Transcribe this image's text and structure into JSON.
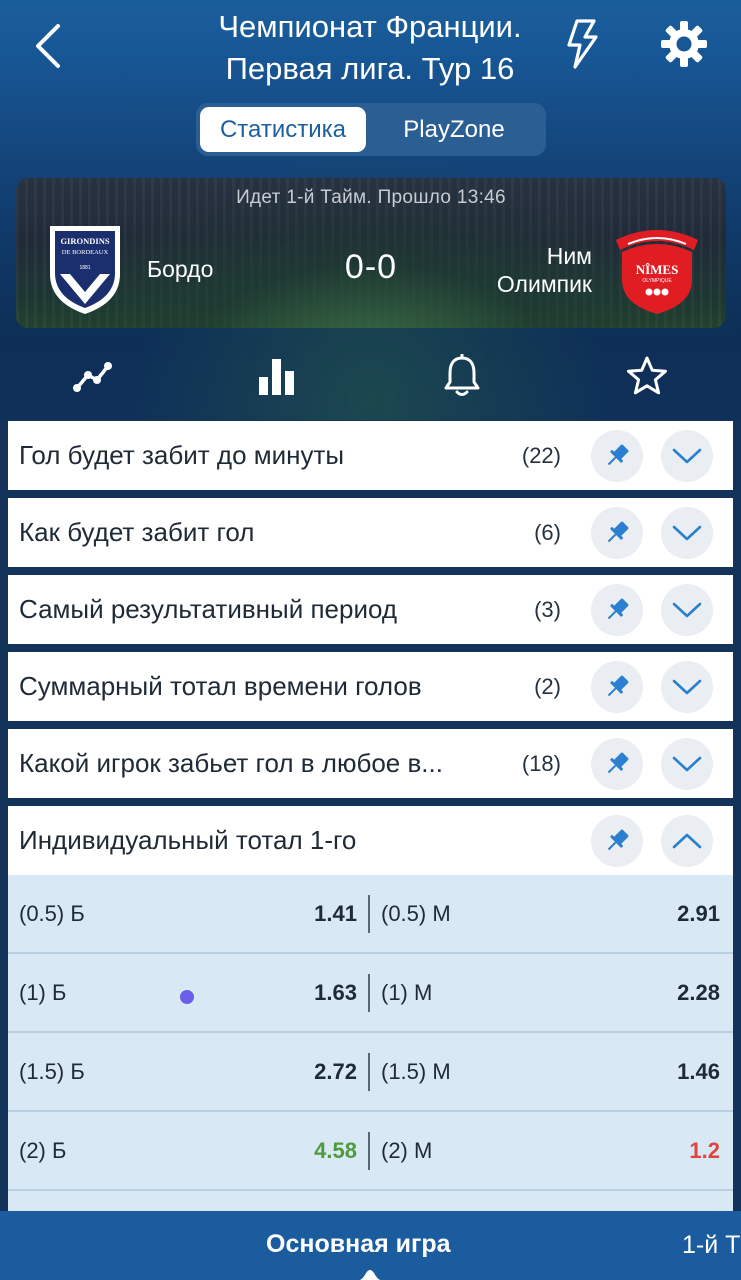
{
  "header": {
    "title_line1": "Чемпионат Франции.",
    "title_line2": "Первая лига. Тур 16"
  },
  "tabs": {
    "stats": "Статистика",
    "playzone": "PlayZone"
  },
  "match": {
    "status": "Идет 1-й Тайм. Прошло 13:46",
    "home_team": "Бордо",
    "away_team_line1": "Ним",
    "away_team_line2": "Олимпик",
    "score": "0-0",
    "home_logo_text_top": "GIRONDINS",
    "home_logo_text_bottom": "DE BORDEAUX",
    "home_logo_year": "1881",
    "away_logo_text": "NÎMES",
    "away_logo_sub": "OLYMPIQUE"
  },
  "markets": [
    {
      "name": "Гол будет забит до минуты",
      "count": "(22)"
    },
    {
      "name": "Как будет забит гол",
      "count": "(6)"
    },
    {
      "name": "Самый результативный период",
      "count": "(3)"
    },
    {
      "name": "Суммарный тотал времени голов",
      "count": "(2)"
    },
    {
      "name": "Какой игрок забьет гол в любое в...",
      "count": "(18)"
    }
  ],
  "expanded_market": {
    "name": "Индивидуальный тотал 1-го",
    "rows": [
      {
        "left_label": "(0.5) Б",
        "left_value": "1.41",
        "right_label": "(0.5) М",
        "right_value": "2.91"
      },
      {
        "left_label": "(1) Б",
        "left_value": "1.63",
        "right_label": "(1) М",
        "right_value": "2.28"
      },
      {
        "left_label": "(1.5) Б",
        "left_value": "2.72",
        "right_label": "(1.5) М",
        "right_value": "1.46"
      },
      {
        "left_label": "(2) Б",
        "left_value": "4.58",
        "right_label": "(2) М",
        "right_value": "1.2"
      }
    ]
  },
  "colors": {
    "odds_up": "#4f9a3c",
    "odds_down": "#e0443d",
    "accent_blue": "#2a7fd0"
  },
  "bottom_tabs": {
    "main": "Основная игра",
    "second": "1-й Т"
  }
}
